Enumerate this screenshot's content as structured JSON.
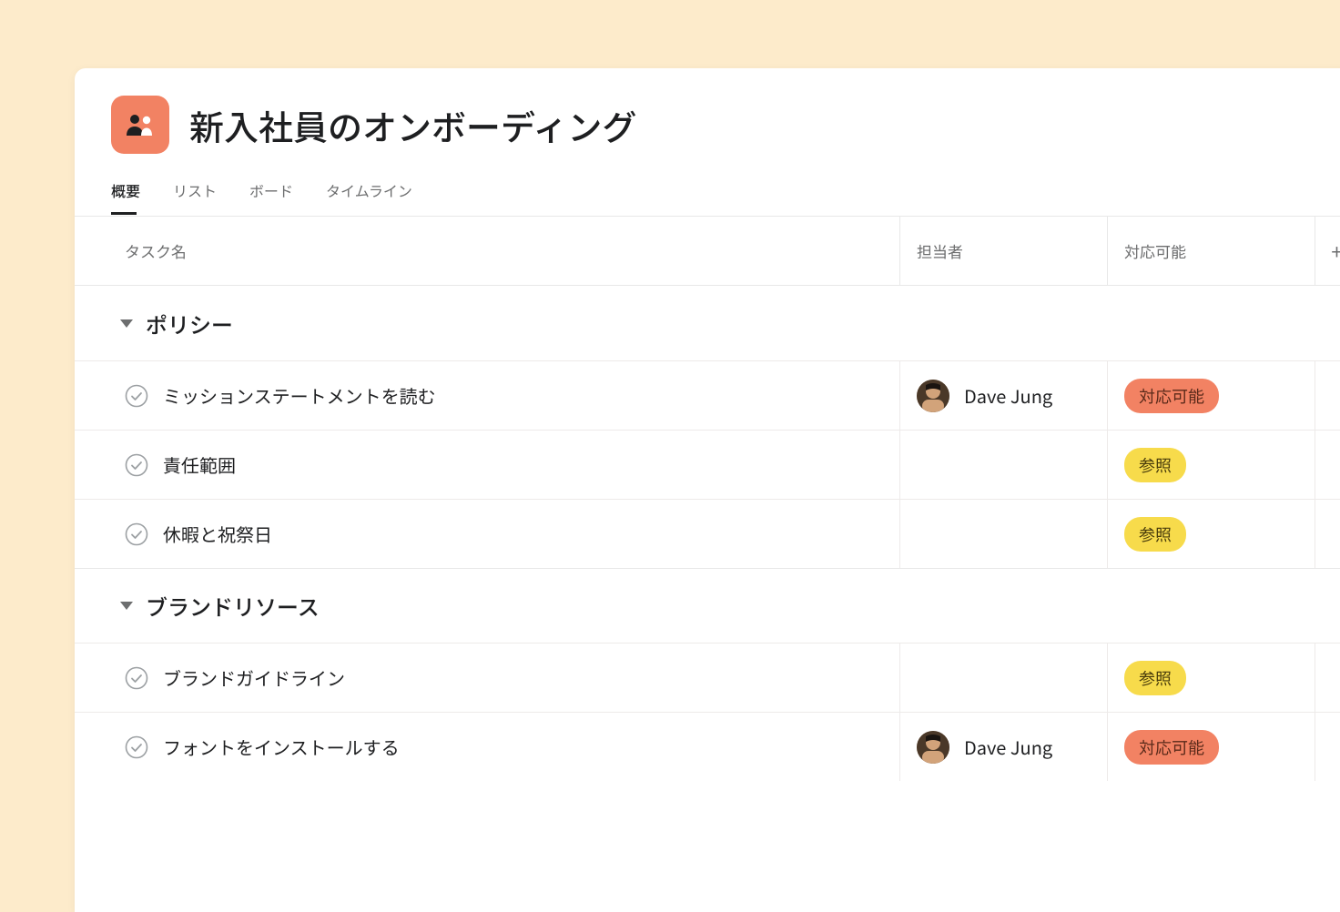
{
  "project": {
    "title": "新入社員のオンボーディング",
    "icon": "people-icon"
  },
  "tabs": [
    {
      "label": "概要",
      "active": true
    },
    {
      "label": "リスト",
      "active": false
    },
    {
      "label": "ボード",
      "active": false
    },
    {
      "label": "タイムライン",
      "active": false
    }
  ],
  "columns": {
    "task_name": "タスク名",
    "assignee": "担当者",
    "status": "対応可能",
    "add": "+"
  },
  "status_labels": {
    "actionable": "対応可能",
    "reference": "参照"
  },
  "sections": [
    {
      "title": "ポリシー",
      "tasks": [
        {
          "name": "ミッションステートメントを読む",
          "assignee": "Dave Jung",
          "status": "actionable"
        },
        {
          "name": "責任範囲",
          "assignee": "",
          "status": "reference"
        },
        {
          "name": "休暇と祝祭日",
          "assignee": "",
          "status": "reference"
        }
      ]
    },
    {
      "title": "ブランドリソース",
      "tasks": [
        {
          "name": "ブランドガイドライン",
          "assignee": "",
          "status": "reference"
        },
        {
          "name": "フォントをインストールする",
          "assignee": "Dave Jung",
          "status": "actionable"
        }
      ]
    }
  ]
}
